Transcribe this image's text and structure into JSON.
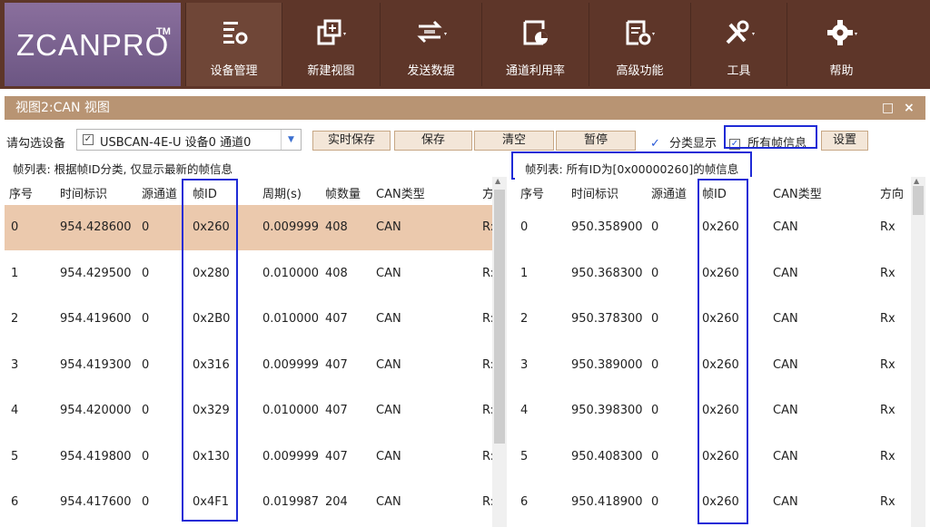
{
  "app": {
    "logo_text": "ZCANPRO",
    "logo_tm": "TM"
  },
  "ribbon": {
    "items": [
      {
        "label": "设备管理",
        "icon": "device-manage-icon"
      },
      {
        "label": "新建视图",
        "icon": "new-view-icon"
      },
      {
        "label": "发送数据",
        "icon": "send-data-icon"
      },
      {
        "label": "通道利用率",
        "icon": "channel-usage-icon"
      },
      {
        "label": "高级功能",
        "icon": "advanced-icon"
      },
      {
        "label": "工具",
        "icon": "tools-icon"
      },
      {
        "label": "帮助",
        "icon": "gear-icon"
      }
    ]
  },
  "view": {
    "title": "视图2:CAN 视图",
    "maximize": "□",
    "close": "×"
  },
  "toolbar": {
    "select_device_label": "请勾选设备",
    "device_value": "USBCAN-4E-U 设备0 通道0",
    "device_checked": "✓",
    "realtime_save": "实时保存",
    "save": "保存",
    "clear": "清空",
    "pause": "暂停",
    "classify_check": "✓",
    "classify_label": "分类显示",
    "all_frames_check": "✓",
    "all_frames_label": "所有帧信息",
    "settings": "设置"
  },
  "left_table": {
    "caption": "帧列表: 根据帧ID分类, 仅显示最新的帧信息",
    "columns": [
      "序号",
      "时间标识",
      "源通道",
      "帧ID",
      "周期(s)",
      "帧数量",
      "CAN类型",
      "方"
    ],
    "rows": [
      [
        "0",
        "954.428600",
        "0",
        "0x260",
        "0.009999",
        "408",
        "CAN",
        "R:"
      ],
      [
        "1",
        "954.429500",
        "0",
        "0x280",
        "0.010000",
        "408",
        "CAN",
        "R:"
      ],
      [
        "2",
        "954.419600",
        "0",
        "0x2B0",
        "0.010000",
        "407",
        "CAN",
        "R:"
      ],
      [
        "3",
        "954.419300",
        "0",
        "0x316",
        "0.009999",
        "407",
        "CAN",
        "R:"
      ],
      [
        "4",
        "954.420000",
        "0",
        "0x329",
        "0.010000",
        "407",
        "CAN",
        "R:"
      ],
      [
        "5",
        "954.419800",
        "0",
        "0x130",
        "0.009999",
        "407",
        "CAN",
        "R:"
      ],
      [
        "6",
        "954.417600",
        "0",
        "0x4F1",
        "0.019987",
        "204",
        "CAN",
        "R:"
      ]
    ]
  },
  "right_table": {
    "caption": "帧列表: 所有ID为[0x00000260]的帧信息",
    "columns": [
      "序号",
      "时间标识",
      "源通道",
      "帧ID",
      "CAN类型",
      "方向"
    ],
    "rows": [
      [
        "0",
        "950.358900",
        "0",
        "0x260",
        "CAN",
        "Rx"
      ],
      [
        "1",
        "950.368300",
        "0",
        "0x260",
        "CAN",
        "Rx"
      ],
      [
        "2",
        "950.378300",
        "0",
        "0x260",
        "CAN",
        "Rx"
      ],
      [
        "3",
        "950.389000",
        "0",
        "0x260",
        "CAN",
        "Rx"
      ],
      [
        "4",
        "950.398300",
        "0",
        "0x260",
        "CAN",
        "Rx"
      ],
      [
        "5",
        "950.408300",
        "0",
        "0x260",
        "CAN",
        "Rx"
      ],
      [
        "6",
        "950.418900",
        "0",
        "0x260",
        "CAN",
        "Rx"
      ]
    ]
  },
  "colors": {
    "ribbon": "#5e3629",
    "logo": "#7a6290",
    "title_bar": "#b89473",
    "selected_row": "#ebc9ad",
    "highlight_box": "#1f2bd6"
  }
}
